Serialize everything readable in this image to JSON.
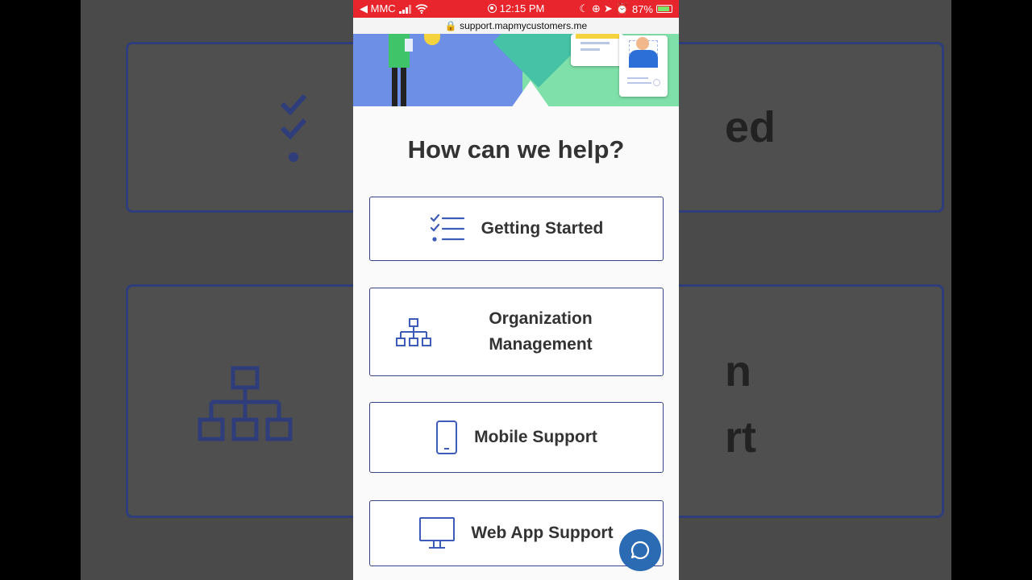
{
  "status_bar": {
    "carrier": "◀ MMC",
    "time": "12:15 PM",
    "battery": "87%"
  },
  "url_bar": {
    "url": "support.mapmycustomers.me"
  },
  "page": {
    "heading": "How can we help?"
  },
  "categories": [
    {
      "label": "Getting Started",
      "icon": "checklist-icon"
    },
    {
      "label": "Organization\nManagement",
      "icon": "org-chart-icon"
    },
    {
      "label": "Mobile Support",
      "icon": "mobile-phone-icon"
    },
    {
      "label": "Web App Support",
      "icon": "monitor-icon"
    }
  ],
  "chat": {
    "icon": "chat-bubble-icon"
  },
  "background_blur": {
    "text_1": "ed",
    "text_2": "n",
    "text_3": "rt"
  },
  "colors": {
    "status_bar": "#e8242c",
    "accent_border": "#34448a",
    "icon_blue": "#3d5bb8",
    "chat_button": "#2a6bb3"
  }
}
